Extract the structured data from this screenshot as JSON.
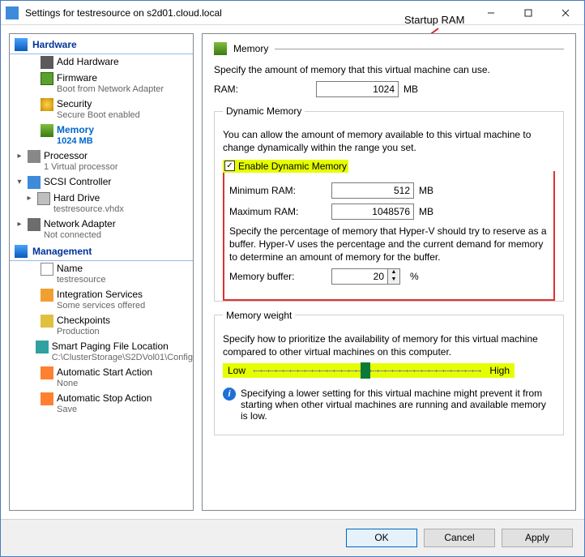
{
  "window": {
    "title": "Settings for testresource on s2d01.cloud.local",
    "annotation_label": "Startup RAM"
  },
  "sidebar": {
    "hardware_label": "Hardware",
    "management_label": "Management",
    "items": {
      "add_hw": "Add Hardware",
      "firmware": "Firmware",
      "firmware_sub": "Boot from Network Adapter",
      "security": "Security",
      "security_sub": "Secure Boot enabled",
      "memory": "Memory",
      "memory_sub": "1024 MB",
      "processor": "Processor",
      "processor_sub": "1 Virtual processor",
      "scsi": "SCSI Controller",
      "hd": "Hard Drive",
      "hd_sub": "testresource.vhdx",
      "net": "Network Adapter",
      "net_sub": "Not connected",
      "name": "Name",
      "name_sub": "testresource",
      "int": "Integration Services",
      "int_sub": "Some services offered",
      "ckp": "Checkpoints",
      "ckp_sub": "Production",
      "spf": "Smart Paging File Location",
      "spf_sub": "C:\\ClusterStorage\\S2DVol01\\Config",
      "asa_start": "Automatic Start Action",
      "asa_start_sub": "None",
      "asa_stop": "Automatic Stop Action",
      "asa_stop_sub": "Save"
    }
  },
  "content": {
    "title": "Memory",
    "intro": "Specify the amount of memory that this virtual machine can use.",
    "ram_label": "RAM:",
    "ram_value": "1024",
    "mb": "MB",
    "dyn": {
      "legend": "Dynamic Memory",
      "desc": "You can allow the amount of memory available to this virtual machine to change dynamically within the range you set.",
      "enable": "Enable Dynamic Memory",
      "min_label": "Minimum RAM:",
      "min_value": "512",
      "max_label": "Maximum RAM:",
      "max_value": "1048576",
      "buffer_desc": "Specify the percentage of memory that Hyper-V should try to reserve as a buffer. Hyper-V uses the percentage and the current demand for memory to determine an amount of memory for the buffer.",
      "buffer_label": "Memory buffer:",
      "buffer_value": "20",
      "percent": "%"
    },
    "weight": {
      "legend": "Memory weight",
      "desc": "Specify how to prioritize the availability of memory for this virtual machine compared to other virtual machines on this computer.",
      "low": "Low",
      "high": "High",
      "info": "Specifying a lower setting for this virtual machine might prevent it from starting when other virtual machines are running and available memory is low."
    }
  },
  "footer": {
    "ok": "OK",
    "cancel": "Cancel",
    "apply": "Apply"
  }
}
